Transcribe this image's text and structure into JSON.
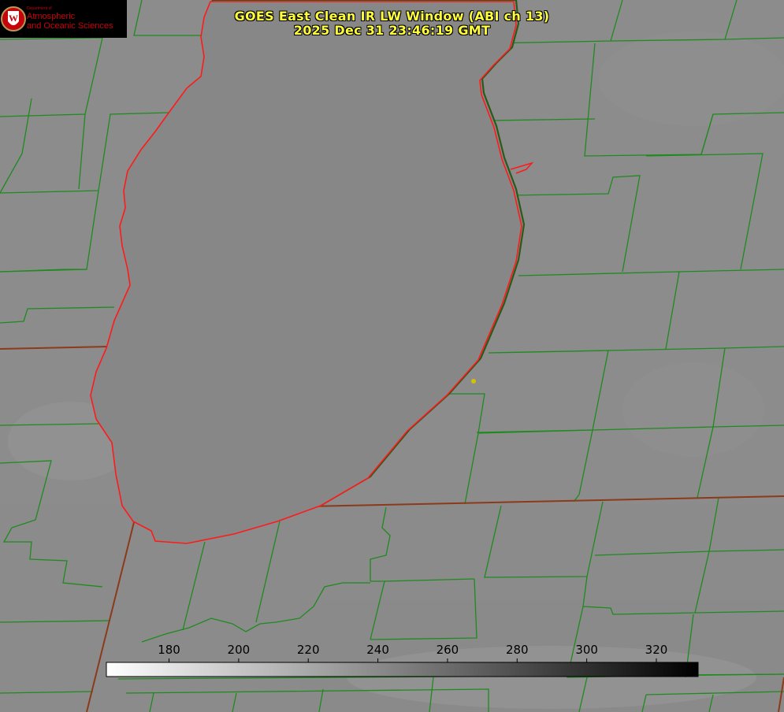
{
  "title": {
    "line1": "GOES East Clean IR LW Window (ABI ch 13)",
    "line2": "2025 Dec 31 23:46:19 GMT"
  },
  "logo": {
    "small_text": "Department of",
    "line1": "Atmospheric",
    "line2": "and Oceanic Sciences",
    "seal_letter": "W"
  },
  "colorbar": {
    "ticks": [
      "180",
      "200",
      "220",
      "240",
      "260",
      "280",
      "300",
      "320"
    ],
    "range": [
      162,
      332
    ],
    "gradient": "white to black"
  },
  "colors": {
    "background": "#8c8c8c",
    "lake": "#878787",
    "county_lines": "#1f8a1f",
    "state_lines": "#8b3a1a",
    "lake_outline": "#ff1a1a",
    "title_text": "#ffff3a",
    "logo_red": "#c5050c",
    "marker": "#d4c200"
  }
}
